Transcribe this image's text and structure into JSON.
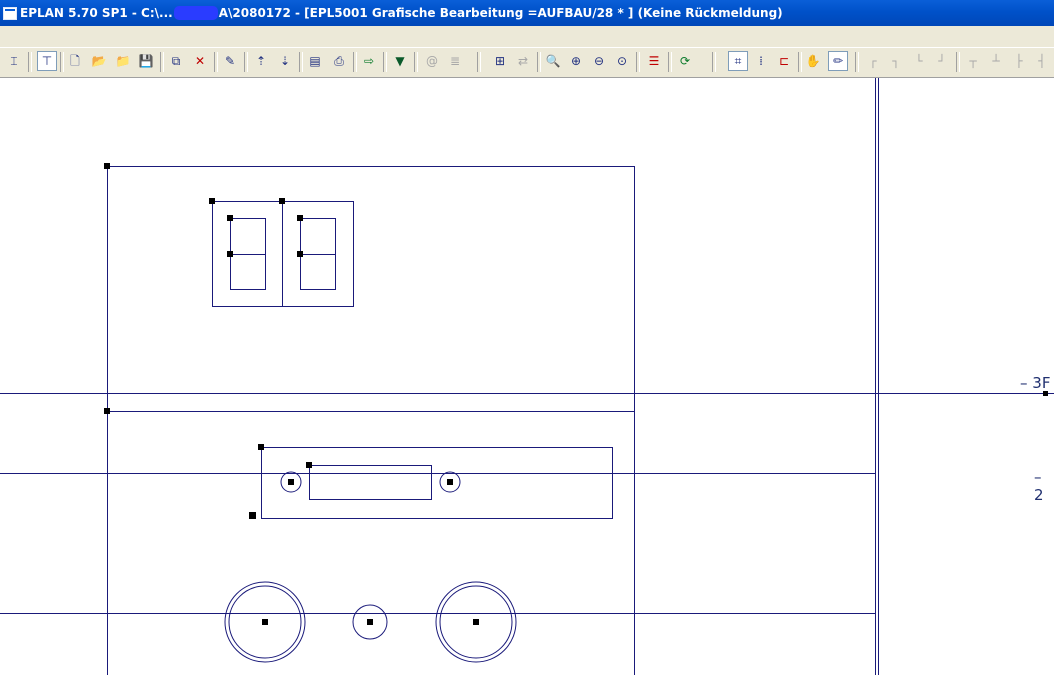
{
  "window": {
    "title_prefix": "EPLAN 5.70 SP1 - C:\\...",
    "title_suffix": "A\\2080172 - [EPL5001 Grafische Bearbeitung =AUFBAU/28   * ] (Keine Rückmeldung)"
  },
  "toolbar": {
    "buttons": [
      {
        "name": "eplan-icon",
        "glyph": "⌶"
      },
      {
        "name": "tree-icon",
        "glyph": "⊤"
      },
      {
        "name": "new-page-icon",
        "glyph": "🗋"
      },
      {
        "name": "open-icon",
        "glyph": "📂"
      },
      {
        "name": "open-project-icon",
        "glyph": "📁"
      },
      {
        "name": "save-icon",
        "glyph": "💾"
      },
      {
        "name": "copy-page-icon",
        "glyph": "⧉"
      },
      {
        "name": "delete-page-icon",
        "glyph": "✕"
      },
      {
        "name": "page-properties-icon",
        "glyph": "✎"
      },
      {
        "name": "page-up-icon",
        "glyph": "⇡"
      },
      {
        "name": "page-down-icon",
        "glyph": "⇣"
      },
      {
        "name": "report-icon",
        "glyph": "▤"
      },
      {
        "name": "print-icon",
        "glyph": "⎙"
      },
      {
        "name": "export-icon",
        "glyph": "⇨"
      },
      {
        "name": "filter-icon",
        "glyph": "▼"
      },
      {
        "name": "link-icon",
        "glyph": "@"
      },
      {
        "name": "document-icon",
        "glyph": "≣"
      },
      {
        "name": "grid-toggle-icon",
        "glyph": "⊞"
      },
      {
        "name": "swap-icon",
        "glyph": "⇄"
      },
      {
        "name": "zoom-icon",
        "glyph": "🔍"
      },
      {
        "name": "zoom-in-icon",
        "glyph": "⊕"
      },
      {
        "name": "zoom-out-icon",
        "glyph": "⊖"
      },
      {
        "name": "zoom-100-icon",
        "glyph": "⊙"
      },
      {
        "name": "bars-icon",
        "glyph": "☰"
      },
      {
        "name": "refresh-icon",
        "glyph": "⟳"
      },
      {
        "name": "snap-icon",
        "glyph": "⌗"
      },
      {
        "name": "dot-grid-icon",
        "glyph": "⁞"
      },
      {
        "name": "connection-icon",
        "glyph": "⊏"
      },
      {
        "name": "hand-icon",
        "glyph": "✋"
      },
      {
        "name": "pencil-icon",
        "glyph": "✏"
      },
      {
        "name": "corner-top-left-icon",
        "glyph": "┌"
      },
      {
        "name": "corner-top-right-icon",
        "glyph": "┐"
      },
      {
        "name": "corner-bottom-left-icon",
        "glyph": "└"
      },
      {
        "name": "corner-bottom-right-icon",
        "glyph": "┘"
      },
      {
        "name": "tee-down-icon",
        "glyph": "┬"
      },
      {
        "name": "tee-up-icon",
        "glyph": "┴"
      },
      {
        "name": "tee-right-icon",
        "glyph": "├"
      },
      {
        "name": "tee-left-icon",
        "glyph": "┤"
      }
    ]
  },
  "drawing": {
    "edge_labels": [
      "3F",
      "2"
    ],
    "line_color": "#1a1a7a"
  }
}
